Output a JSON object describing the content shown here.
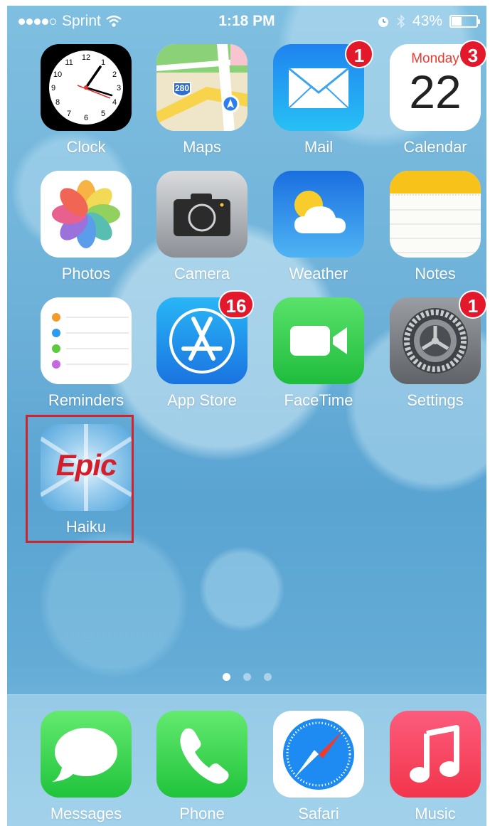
{
  "status_bar": {
    "carrier": "Sprint",
    "time": "1:18 PM",
    "battery": "43%",
    "battery_level": 0.43
  },
  "apps": [
    {
      "name": "Clock",
      "icon": "clock-icon"
    },
    {
      "name": "Maps",
      "icon": "maps-icon",
      "route_sign": "280"
    },
    {
      "name": "Mail",
      "icon": "mail-icon",
      "badge": "1"
    },
    {
      "name": "Calendar",
      "icon": "calendar-icon",
      "badge": "3",
      "weekday": "Monday",
      "day": "22"
    },
    {
      "name": "Photos",
      "icon": "photos-icon"
    },
    {
      "name": "Camera",
      "icon": "camera-icon"
    },
    {
      "name": "Weather",
      "icon": "weather-icon"
    },
    {
      "name": "Notes",
      "icon": "notes-icon"
    },
    {
      "name": "Reminders",
      "icon": "reminders-icon"
    },
    {
      "name": "App Store",
      "icon": "app-store-icon",
      "badge": "16"
    },
    {
      "name": "FaceTime",
      "icon": "facetime-icon"
    },
    {
      "name": "Settings",
      "icon": "settings-icon",
      "badge": "1"
    },
    {
      "name": "Haiku",
      "icon": "epic-haiku-icon",
      "logo_text": "Epic"
    }
  ],
  "page_indicator": {
    "pages": 3,
    "current": 1
  },
  "dock": [
    {
      "name": "Messages",
      "icon": "messages-icon"
    },
    {
      "name": "Phone",
      "icon": "phone-icon"
    },
    {
      "name": "Safari",
      "icon": "safari-icon"
    },
    {
      "name": "Music",
      "icon": "music-icon"
    }
  ],
  "colors": {
    "badge": "#e3192b",
    "highlight_box": "#d2222a",
    "epic_red": "#d31f2b"
  }
}
